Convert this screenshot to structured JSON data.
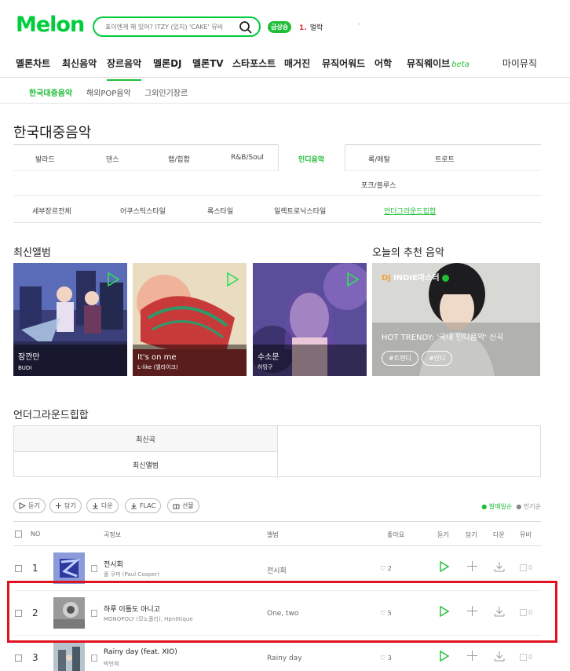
{
  "header": {
    "logo": "Melon",
    "search_placeholder": "표이엔게 해 있어? ITZY (있지) 'CAKE' 뮤비",
    "rank_badge": "급상승",
    "rank_num": "1.",
    "rank_text": "멀락"
  },
  "gnb": {
    "items": [
      "멜론차트",
      "최신음악",
      "장르음악",
      "멜론DJ",
      "멜론TV",
      "스타포스트",
      "매거진",
      "뮤직어워드",
      "어학",
      "뮤직웨이브"
    ],
    "beta": "beta",
    "right": "마이뮤직"
  },
  "subnav": [
    "한국대중음악",
    "해외POP음악",
    "그외인기장르"
  ],
  "page_title": "한국대중음악",
  "genres": [
    "발라드",
    "댄스",
    "랩/힙합",
    "R&B/Soul",
    "인디음악",
    "록/메탈",
    "트로트",
    "포크/블루스"
  ],
  "styles": [
    "세부장르전체",
    "어쿠스틱스타일",
    "록스타일",
    "일렉트로닉스타일",
    "언더그라운드힙합"
  ],
  "latest_albums": {
    "title": "최신앨범",
    "items": [
      {
        "title": "잠깐만",
        "artist": "BUDI"
      },
      {
        "title": "It's on me",
        "artist": "L-like (엘라이크)"
      },
      {
        "title": "수소문",
        "artist": "허밍구"
      }
    ]
  },
  "recommend": {
    "title": "오늘의 추천 음악",
    "badge_dj": "DJ",
    "badge": "INDIE마스터",
    "headline": "HOT TRENDY: '국내 인디음악' 신곡",
    "tags": [
      "#트렌디",
      "#인디"
    ]
  },
  "underground": {
    "title": "언더그라운드힙합",
    "tabs": [
      "최신곡",
      "최신앨범"
    ]
  },
  "toolbar": {
    "buttons": [
      "듣기",
      "담기",
      "다운",
      "FLAC",
      "선물"
    ],
    "sort_on": "발매일순",
    "sort_off": "인기순"
  },
  "table": {
    "headers": [
      "NO",
      "곡정보",
      "앨범",
      "좋아요",
      "듣기",
      "담기",
      "다운",
      "뮤비"
    ],
    "rows": [
      {
        "no": "1",
        "song": "전시회",
        "artist": "폴 쿠퍼 (Paul Cooper)",
        "album": "전시회",
        "likes": "2",
        "mv": "0"
      },
      {
        "no": "2",
        "song": "하루 이틀도 아니고",
        "artist": "MONOPOLY (모노폴리), Hpn0tique",
        "album": "One, two",
        "likes": "5",
        "mv": "0"
      },
      {
        "no": "3",
        "song": "Rainy day (feat. XIO)",
        "artist": "박언제",
        "album": "Rainy day",
        "likes": "3",
        "mv": "0"
      }
    ]
  },
  "colors": {
    "brand": "#00cd3c",
    "accent": "#1fbe37",
    "highlight": "#e0121f"
  }
}
